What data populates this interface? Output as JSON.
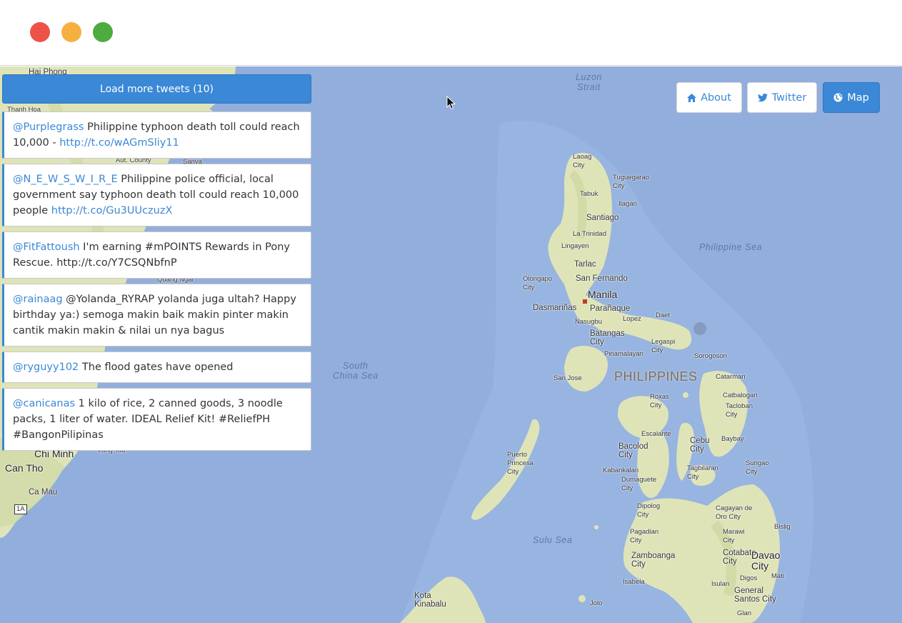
{
  "window": {
    "buttons": [
      "close",
      "minimize",
      "zoom"
    ]
  },
  "toolbar": {
    "load_more_label": "Load more tweets (10)"
  },
  "nav": {
    "about": {
      "label": "About",
      "icon": "home-icon"
    },
    "twitter": {
      "label": "Twitter",
      "icon": "twitter-bird-icon"
    },
    "map": {
      "label": "Map",
      "icon": "globe-icon",
      "active": true
    }
  },
  "tweets": [
    {
      "user": "@Purplegrass",
      "text": " Philippine typhoon death toll could reach 10,000 - ",
      "link": "http://t.co/wAGmSliy11"
    },
    {
      "user": "@N_E_W_S_W_I_R_E",
      "text": " Philippine police official, local government say typhoon death toll could reach 10,000 people ",
      "link": "http://t.co/Gu3UUczuzX"
    },
    {
      "user": "@FitFattoush",
      "text": " I'm earning #mPOINTS Rewards in Pony Rescue. http://t.co/Y7CSQNbfnP",
      "link": ""
    },
    {
      "user": "@rainaag",
      "text": " @Yolanda_RYRAP yolanda juga ultah? Happy birthday ya:) semoga makin baik makin pinter makin cantik makin makin & nilai un nya bagus",
      "link": ""
    },
    {
      "user": "@ryguyy102",
      "text": " The flood gates have opened",
      "link": ""
    },
    {
      "user": "@canicanas",
      "text": " 1 kilo of rice, 2 canned goods, 3 noodle packs, 1 liter of water. IDEAL Relief Kit! #ReliefPH #BangonPilipinas",
      "link": ""
    }
  ],
  "map": {
    "country": "PHILIPPINES",
    "water": {
      "luzon_strait": "Luzon\nStrait",
      "philippine_sea": "Philippine Sea",
      "south_china_sea": "South\nChina Sea",
      "sulu_sea": "Sulu Sea"
    },
    "cities": {
      "hai_phong": "Hai Phong",
      "thanh_hoa": "Thanh Hoa",
      "aut_county": "Aut. County",
      "sanya": "Sanya",
      "quang_ngai": "Quang Ngai",
      "chi_minh": "Chi Minh",
      "vung_tau": "Vung Tau",
      "can_tho": "Can Tho",
      "ca_mau": "Ca Mau",
      "road_1a": "1A",
      "laoag": "Laoag\nCity",
      "tuguegarao": "Tuguegarao\nCity",
      "tabuk": "Tabuk",
      "ilagan": "Ilagan",
      "santiago": "Santiago",
      "la_trinidad": "La Trinidad",
      "lingayen": "Lingayen",
      "tarlac": "Tarlac",
      "olongapo": "Olongapo\nCity",
      "san_fernando": "San Fernando",
      "manila": "Manila",
      "dasmarinas": "Dasmariñas",
      "paranaque": "Parañaque",
      "lopez": "Lopez",
      "daet": "Daet",
      "nasugbu": "Nasugbu",
      "batangas": "Batangas\nCity",
      "pinamalayan": "Pinamalayan",
      "legaspi": "Legaspi\nCity",
      "sorogoson": "Sorogoson",
      "san_jose": "San Jose",
      "catarman": "Catarman",
      "roxas": "Roxas\nCity",
      "catbalogan": "Catbalogan",
      "tacloban": "Tacloban\nCity",
      "escalante": "Escalante",
      "bacolod": "Bacolod\nCity",
      "cebu": "Cebu\nCity",
      "baybay": "Baybay",
      "puerto_princesa": "Puerto\nPrincesa\nCity",
      "kabankalan": "Kabankalan",
      "dumaguete": "Dumaguete\nCity",
      "tagbilaran": "Tagbilaran\nCity",
      "surigao": "Surigao\nCity",
      "dipolog": "Dipolog\nCity",
      "cagayan_de_oro": "Cagayan de\nOro City",
      "bislig": "Bislig",
      "pagadian": "Pagadian\nCity",
      "marawi": "Marawi\nCity",
      "zamboanga": "Zamboanga\nCity",
      "cotabato": "Cotabato\nCity",
      "davao": "Davao\nCity",
      "isabela": "Isabela",
      "digos": "Digos",
      "mati": "Mati",
      "isulan": "Isulan",
      "general_santos": "General\nSantos City",
      "kota_kinabalu": "Kota\nKinabalu",
      "jolo": "Jolo",
      "glan": "Glan"
    }
  },
  "colors": {
    "accent": "#3a88d6",
    "sea": "#92aedd",
    "land": "#dfe4b8"
  }
}
